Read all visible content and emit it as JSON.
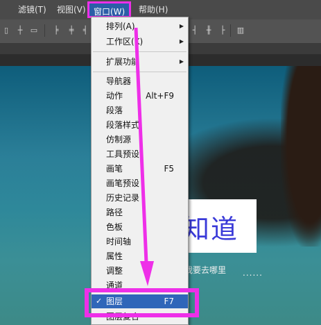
{
  "menubar": {
    "items": [
      {
        "label": "滤镜(T)"
      },
      {
        "label": "视图(V)"
      },
      {
        "label": "窗口(W)"
      },
      {
        "label": "帮助(H)"
      }
    ]
  },
  "menu": {
    "items": [
      {
        "label": "排列(A)",
        "submenu": true
      },
      {
        "label": "工作区(K)",
        "submenu": true
      },
      {
        "label": "扩展功能",
        "submenu": true
      },
      {
        "label": "导航器"
      },
      {
        "label": "动作",
        "shortcut": "Alt+F9"
      },
      {
        "label": "段落"
      },
      {
        "label": "段落样式"
      },
      {
        "label": "仿制源"
      },
      {
        "label": "工具预设"
      },
      {
        "label": "画笔",
        "shortcut": "F5"
      },
      {
        "label": "画笔预设"
      },
      {
        "label": "历史记录"
      },
      {
        "label": "路径"
      },
      {
        "label": "色板"
      },
      {
        "label": "时间轴"
      },
      {
        "label": "属性"
      },
      {
        "label": "调整"
      },
      {
        "label": "通道"
      },
      {
        "label": "图层",
        "shortcut": "F7",
        "checked": true,
        "highlighted": true
      },
      {
        "label": "图层复合"
      }
    ],
    "check_mark": "✓",
    "arrow_glyph": "▶"
  },
  "canvas": {
    "big_text": "知道",
    "subtitle": "我要去哪里",
    "dots": "......"
  },
  "colors": {
    "annotation": "#ee2fe8",
    "menu_highlight": "#2f66b9"
  }
}
